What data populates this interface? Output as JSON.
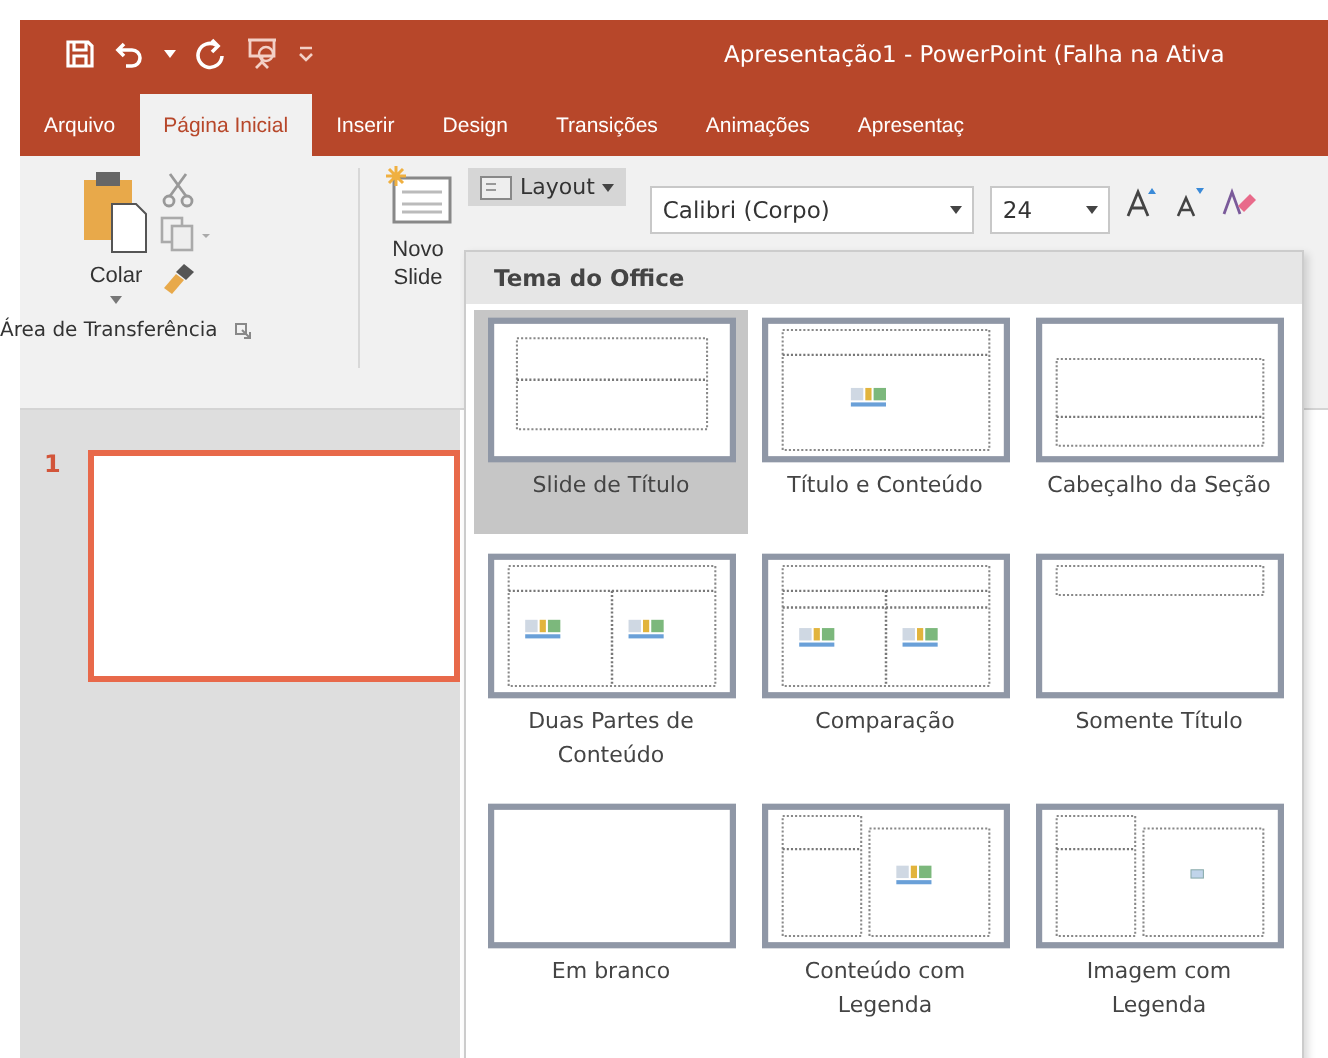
{
  "window": {
    "title": "Apresentação1  -  PowerPoint (Falha na Ativa"
  },
  "tabs": [
    {
      "label": "Arquivo",
      "selected": false
    },
    {
      "label": "Página Inicial",
      "selected": true
    },
    {
      "label": "Inserir",
      "selected": false
    },
    {
      "label": "Design",
      "selected": false
    },
    {
      "label": "Transições",
      "selected": false
    },
    {
      "label": "Animações",
      "selected": false
    },
    {
      "label": "Apresentaç",
      "selected": false
    }
  ],
  "clipboard": {
    "paste": "Colar",
    "group_label": "Área de Transferência"
  },
  "new_slide": {
    "label": "Novo Slide"
  },
  "layout_button": {
    "label": "Layout"
  },
  "font": {
    "family": "Calibri (Corpo)",
    "size": "24"
  },
  "slides": [
    {
      "number": "1",
      "selected": true
    }
  ],
  "layout_menu": {
    "heading": "Tema do Office",
    "items": [
      {
        "label": "Slide de Título",
        "kind": "title",
        "selected": true
      },
      {
        "label": "Título e Conteúdo",
        "kind": "title-content",
        "selected": false
      },
      {
        "label": "Cabeçalho da Seção",
        "kind": "section",
        "selected": false
      },
      {
        "label": "Duas Partes de Conteúdo",
        "kind": "two-content",
        "selected": false
      },
      {
        "label": "Comparação",
        "kind": "comparison",
        "selected": false
      },
      {
        "label": "Somente Título",
        "kind": "title-only",
        "selected": false
      },
      {
        "label": "Em branco",
        "kind": "blank",
        "selected": false
      },
      {
        "label": "Conteúdo com Legenda",
        "kind": "content-caption",
        "selected": false
      },
      {
        "label": "Imagem com Legenda",
        "kind": "picture-caption",
        "selected": false
      }
    ]
  }
}
